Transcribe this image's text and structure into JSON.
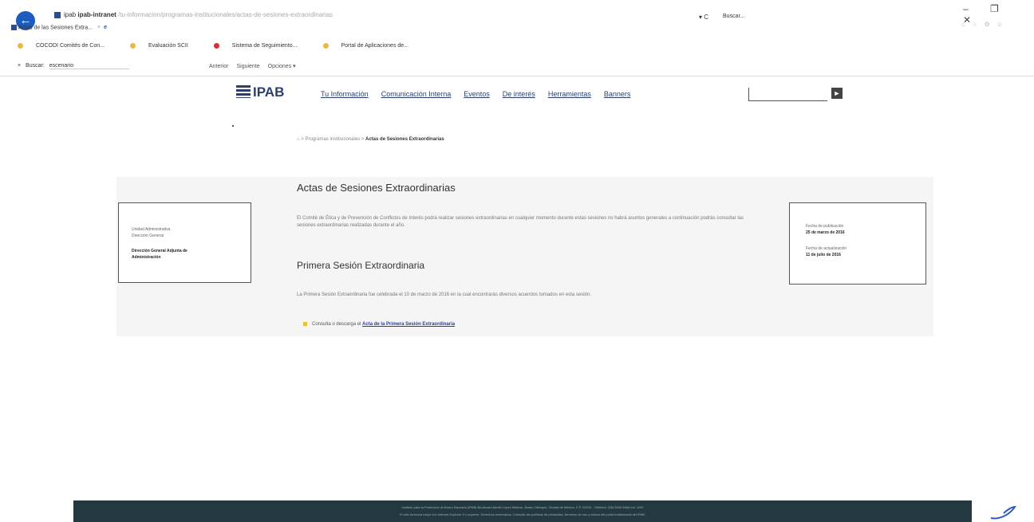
{
  "browser": {
    "address_prefix": "ipab",
    "address_text": "ipab-intranet",
    "address_rest": "/tu-informacion/programas-institucionales/actas-de-sesiones-extraordinarias",
    "tab_title": "Actas de las Sesiones Extra...",
    "search_placeholder": "Buscar...",
    "window_controls": "– ❐ ✕",
    "right_icons": "⌂ ☆ ⚙ ☺",
    "favorites": [
      {
        "label": "COCODI Comités de Con...",
        "color": "#e8b84a"
      },
      {
        "label": "Evaluación SCII",
        "color": "#e8b84a"
      },
      {
        "label": "Sistema de Seguimiento...",
        "color": "#c33"
      },
      {
        "label": "Portal de Aplicaciones de...",
        "color": "#e8b84a"
      }
    ],
    "find": {
      "close": "×",
      "label": "Buscar:",
      "value": "escenario",
      "prev": "Anterior",
      "next": "Siguiente",
      "options": "Opciones ▾"
    }
  },
  "site": {
    "logo_text": "IPAB",
    "nav": [
      "Tu Información",
      "Comunicación Interna",
      "Eventos",
      "De interés",
      "Herramientas",
      "Banners"
    ],
    "search_button": "►",
    "breadcrumb_prefix": "⌂ > Programas institucionales >",
    "breadcrumb_current": "Actas de Sesiones Extraordinarias"
  },
  "left_box": {
    "line1": "Unidad Administrativa",
    "line2": "Dirección General",
    "bold1": "Dirección General Adjunta de",
    "bold2": "Administración"
  },
  "right_box": {
    "pub_label": "Fecha de publicación",
    "pub_date": "25 de marzo de 2016",
    "upd_label": "Fecha de actualización",
    "upd_date": "11 de julio de 2016"
  },
  "content": {
    "title": "Actas de Sesiones Extraordinarias",
    "intro": "El Comité de Ética y de Prevención de Conflictos de Interés podrá realizar sesiones extraordinarias en cualquier momento durante estas sesiones no habrá asuntos generales a continuación podrás consultar las sesiones extraordinarias realizadas durante el año.",
    "section_title": "Primera Sesión Extraordinaria",
    "section_text": "La Primera Sesión Extraordinaria fue celebrada el 10 de marzo de 2016 en la cual encontrarás diversos acuerdos tomados en esta sesión.",
    "bullet_text": "Consulta o descarga el",
    "bullet_link": "Acta de la Primera Sesión Extraordinaria"
  },
  "footer": {
    "line1": "Instituto para la Protección al Ahorro Bancario (IPAB) Boulevard Adolfo López Mateos, Álvaro Obregón, Ciudad de México, C.P. 01010 - Teléfono: (55) 5000 6464 ext. 1100",
    "line2": "El sitio funciona mejor con Internet Explorer 9 o superior. Derechos reservados. Consulte las políticas de privacidad, términos de uso y avisos del portal institucional del IPAB."
  }
}
